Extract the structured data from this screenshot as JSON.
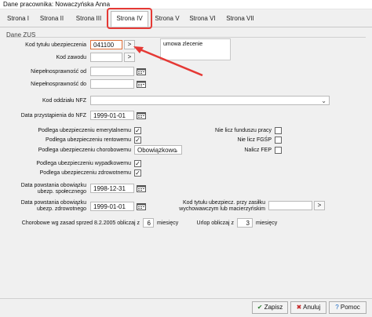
{
  "window": {
    "title": "Dane pracownika: Nowaczyńska Anna"
  },
  "tabs": [
    {
      "label": "Strona I"
    },
    {
      "label": "Strona II"
    },
    {
      "label": "Strona III"
    },
    {
      "label": "Strona IV"
    },
    {
      "label": "Strona V"
    },
    {
      "label": "Strona VI"
    },
    {
      "label": "Strona VII"
    }
  ],
  "active_tab": "Strona IV",
  "section_title": "Dane ZUS",
  "fields": {
    "kod_tytulu": {
      "label": "Kod tytułu ubezpieczenia",
      "value": "041100",
      "button": ">",
      "description": "umowa zlecenie"
    },
    "kod_zawodu": {
      "label": "Kod zawodu",
      "button": ">"
    },
    "niepeln_od": {
      "label": "Niepełnosprawność od"
    },
    "niepeln_do": {
      "label": "Niepełnosprawność do"
    },
    "kod_nfz": {
      "label": "Kod oddziału NFZ"
    },
    "data_nfz": {
      "label": "Data przystąpienia do NFZ",
      "value": "1999-01-01"
    },
    "emerytalne": {
      "label": "Podlega ubezpieczeniu emerytalnemu",
      "checked": "✓"
    },
    "rentowe": {
      "label": "Podlega ubezpieczeniu rentowemu",
      "checked": "✓"
    },
    "chorobowe": {
      "label": "Podlega ubezpieczeniu chorobowemu",
      "value": "Obowiązkowo"
    },
    "wypadkowe": {
      "label": "Podlega ubezpieczeniu wypadkowemu",
      "checked": "✓"
    },
    "zdrowotne": {
      "label": "Podlega ubezpieczeniu zdrowotnemu",
      "checked": "✓"
    },
    "fp": {
      "label": "Nie licz funduszu pracy",
      "checked": ""
    },
    "fgsp": {
      "label": "Nie licz FGŚP",
      "checked": ""
    },
    "fep": {
      "label": "Nalicz FEP",
      "checked": ""
    },
    "data_spol": {
      "label_line1": "Data powstania obowiązku",
      "label_line2": "ubezp. społecznego",
      "value": "1998-12-31"
    },
    "data_zdrow": {
      "label_line1": "Data powstania obowiązku",
      "label_line2": "ubezp. zdrowotnego",
      "value": "1999-01-01"
    },
    "kod_zasilku": {
      "label_line1": "Kod tytułu ubezpiecz. przy zasiłku",
      "label_line2": "wychowawczym lub macierzyńskim",
      "button": ">"
    },
    "chorobowe_2005": {
      "label": "Chorobowe wg zasad sprzed 8.2.2005 obliczaj z",
      "value": "6",
      "suffix": "miesięcy"
    },
    "urlop": {
      "label": "Urlop obliczaj z",
      "value": "3",
      "suffix": "miesięcy"
    }
  },
  "buttons": {
    "save": "Zapisz",
    "cancel": "Anuluj",
    "help": "Pomoc"
  },
  "colors": {
    "highlight": "#e53935",
    "accent_border": "#e0703a"
  }
}
